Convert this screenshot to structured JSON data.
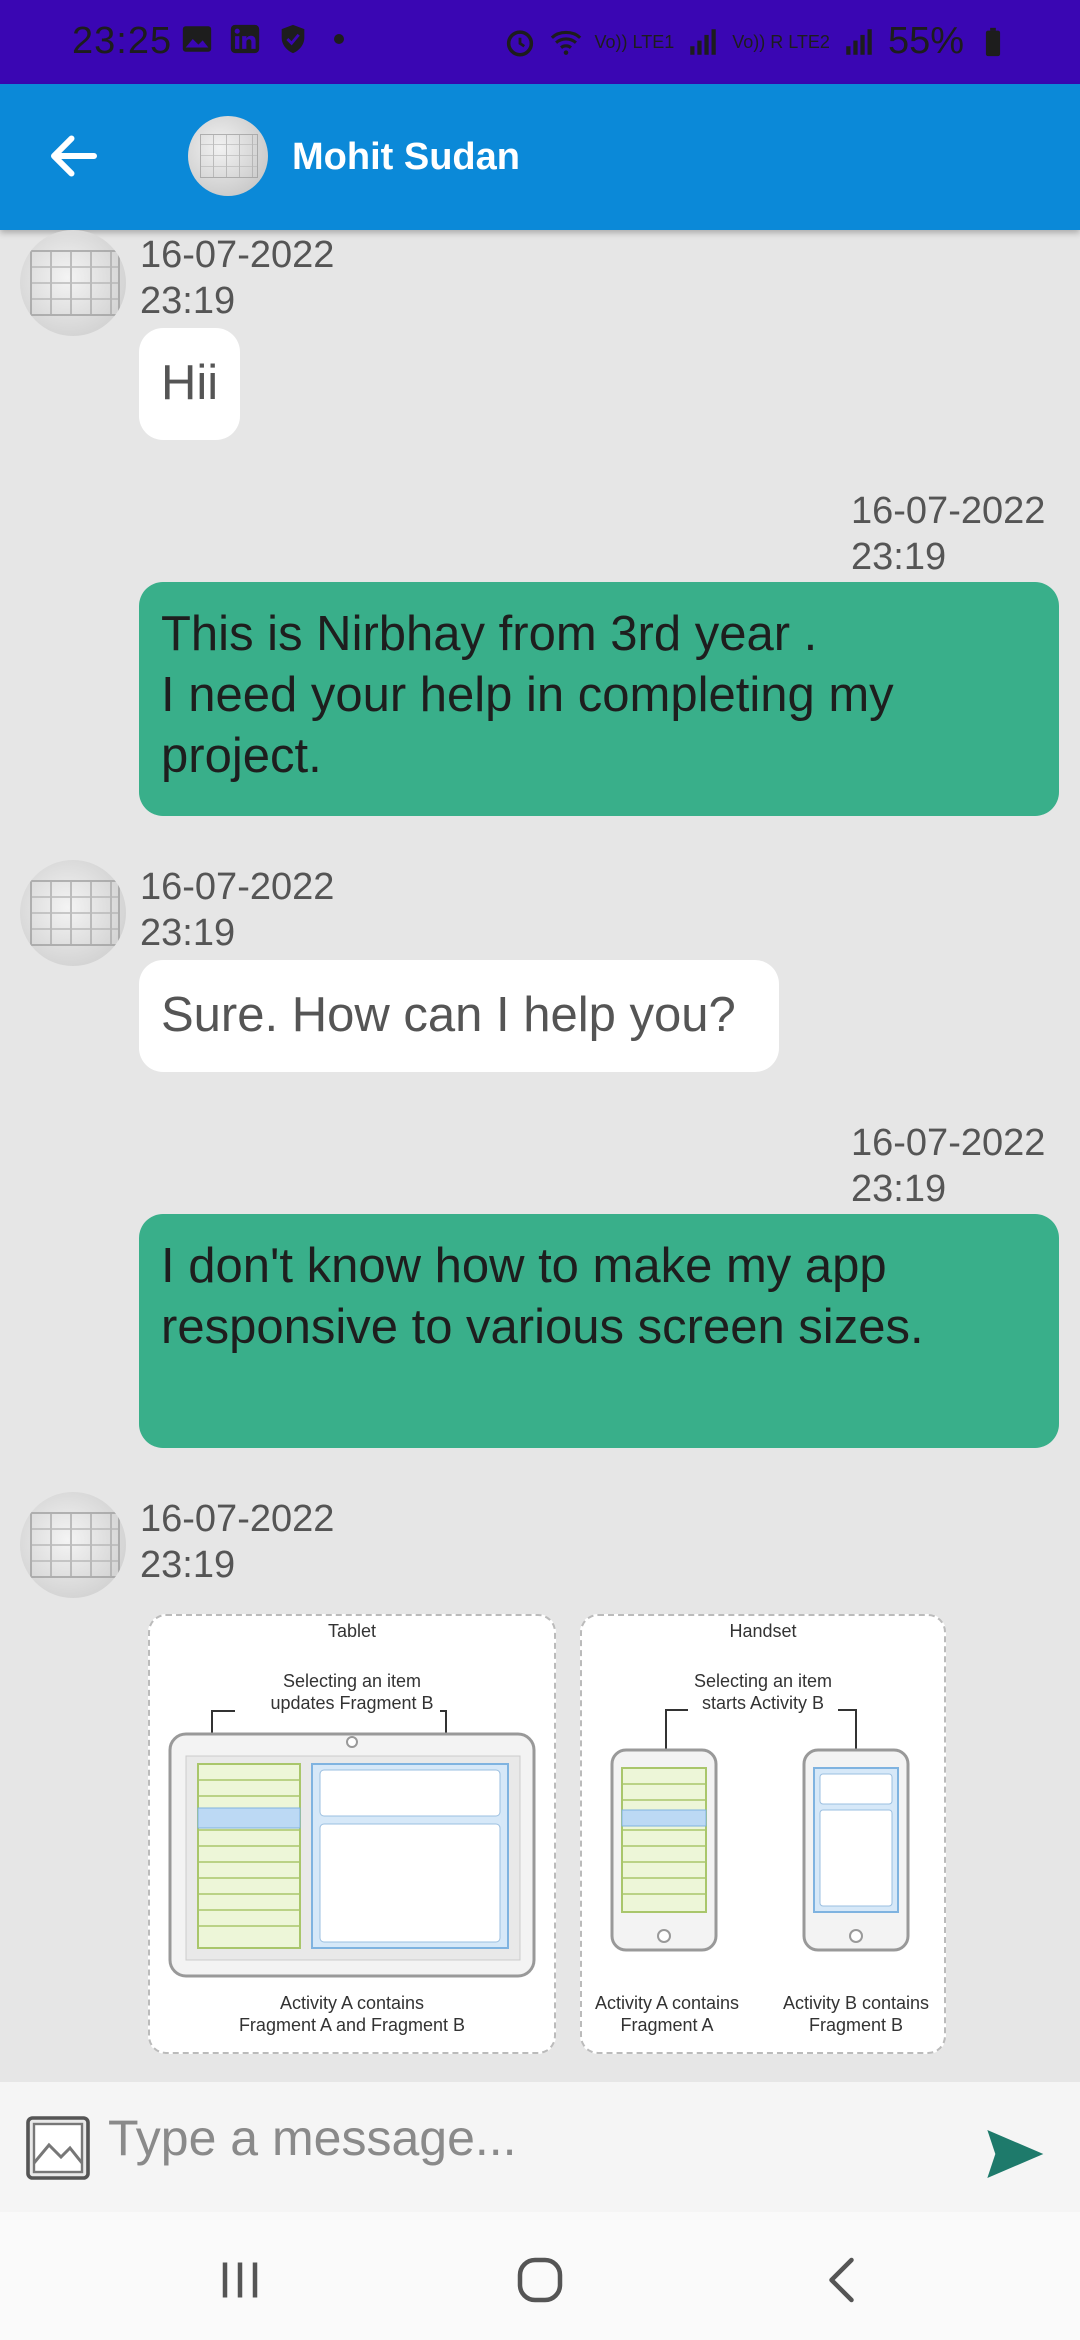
{
  "status_bar": {
    "time": "23:25",
    "battery": "55%",
    "sim1": "Vo)) LTE1",
    "sim2": "Vo)) R LTE2",
    "icons": [
      "gallery-icon",
      "linkedin-icon",
      "shield-icon",
      "dot-icon",
      "alarm-icon",
      "wifi-icon",
      "signal-icon",
      "battery-icon"
    ]
  },
  "app_bar": {
    "contact_name": "Mohit Sudan",
    "back_icon": "arrow-back-icon"
  },
  "messages": [
    {
      "direction": "incoming",
      "date": "16-07-2022",
      "time": "23:19",
      "text": "Hii"
    },
    {
      "direction": "outgoing",
      "date": "16-07-2022",
      "time": "23:19",
      "text_lines": [
        "This is Nirbhay from 3rd year .",
        "I need your help in completing my",
        "project."
      ]
    },
    {
      "direction": "incoming",
      "date": "16-07-2022",
      "time": "23:19",
      "text": "Sure. How can I help you?"
    },
    {
      "direction": "outgoing",
      "date": "16-07-2022",
      "time": "23:19",
      "text_lines": [
        "I don't know how to make my app",
        "responsive to various screen sizes."
      ]
    },
    {
      "direction": "incoming",
      "date": "16-07-2022",
      "time": "23:19",
      "image": {
        "tablet_title": "Tablet",
        "handset_title": "Handset",
        "tablet_note_1": "Selecting an item",
        "tablet_note_2": "updates Fragment B",
        "handset_note_1": "Selecting an item",
        "handset_note_2": "starts Activity B",
        "tablet_caption_1": "Activity A contains",
        "tablet_caption_2": "Fragment A and Fragment B",
        "handset_a_caption_1": "Activity A contains",
        "handset_a_caption_2": "Fragment A",
        "handset_b_caption_1": "Activity B contains",
        "handset_b_caption_2": "Fragment B"
      }
    }
  ],
  "input": {
    "placeholder": "Type a message...",
    "attach_icon": "image-icon",
    "send_icon": "send-icon"
  },
  "nav_bar": {
    "icons": [
      "recent-apps-icon",
      "home-icon",
      "back-icon"
    ]
  },
  "colors": {
    "status_bar": "#3a06b3",
    "app_bar": "#0b89d8",
    "chat_background": "#e6e6e6",
    "outgoing_bubble": "#39af8a",
    "incoming_bubble": "#ffffff",
    "send_icon": "#1e7a6b"
  }
}
